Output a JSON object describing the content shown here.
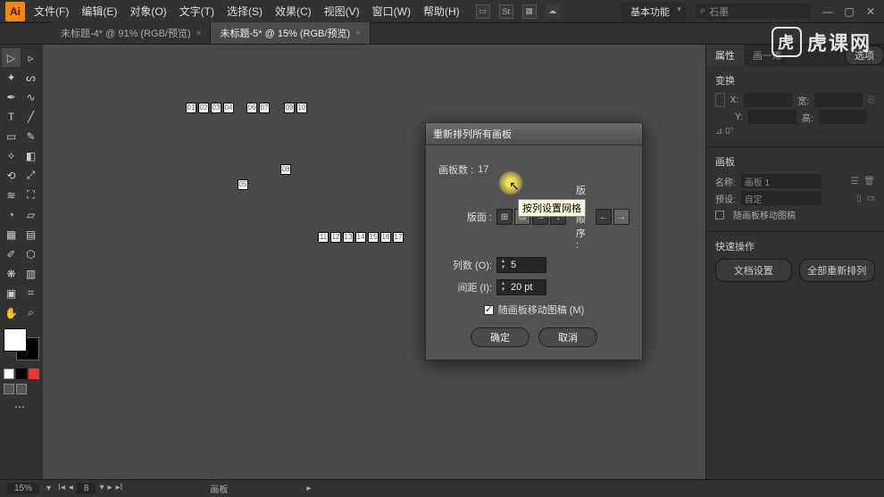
{
  "app": {
    "logo": "Ai"
  },
  "menu": {
    "file": "文件(F)",
    "edit": "编辑(E)",
    "object": "对象(O)",
    "type": "文字(T)",
    "select": "选择(S)",
    "effect": "效果(C)",
    "view": "视图(V)",
    "window": "窗口(W)",
    "help": "帮助(H)"
  },
  "workspace": {
    "label": "基本功能"
  },
  "search": {
    "icon": "⌕",
    "value": "石墨"
  },
  "tabs": [
    {
      "label": "未标题-4* @ 91% (RGB/预览)",
      "active": false
    },
    {
      "label": "未标题-5* @ 15% (RGB/预览)",
      "active": true
    }
  ],
  "right": {
    "tabs": {
      "properties": "属性",
      "libraries": "画一库",
      "layers": "选项"
    },
    "transform": {
      "header": "变换",
      "x": "X:",
      "y": "Y:",
      "w": "宽:",
      "h": "高:"
    },
    "artboards": {
      "header": "画板",
      "name_label": "名称:",
      "name_value": "画板 1",
      "preset_label": "预设:",
      "preset_value": "自定",
      "move_with": "随画板移动图稿"
    },
    "quick": {
      "header": "快速操作",
      "doc_setup": "文档设置",
      "rearrange_all": "全部重新排列"
    }
  },
  "dialog": {
    "title": "重新排列所有画板",
    "count_label": "画板数 :",
    "count_value": "17",
    "layout_label": "版面 :",
    "order_label": "版面顺序 :",
    "cols_label": "列数 (O):",
    "cols_value": "5",
    "spacing_label": "间距 (I):",
    "spacing_value": "20 pt",
    "tooltip": "按列设置网格",
    "move_art": "随画板移动图稿 (M)",
    "ok": "确定",
    "cancel": "取消"
  },
  "status": {
    "zoom": "15%",
    "artboard": "8",
    "panel_label": "画板"
  },
  "watermark": {
    "text": "虎课网"
  },
  "artboards_row1": [
    "01",
    "02",
    "03",
    "04",
    "",
    "06",
    "07",
    "",
    "09",
    "10"
  ],
  "artboards_row3": [
    "11",
    "12",
    "13",
    "14",
    "15",
    "16",
    "17"
  ]
}
